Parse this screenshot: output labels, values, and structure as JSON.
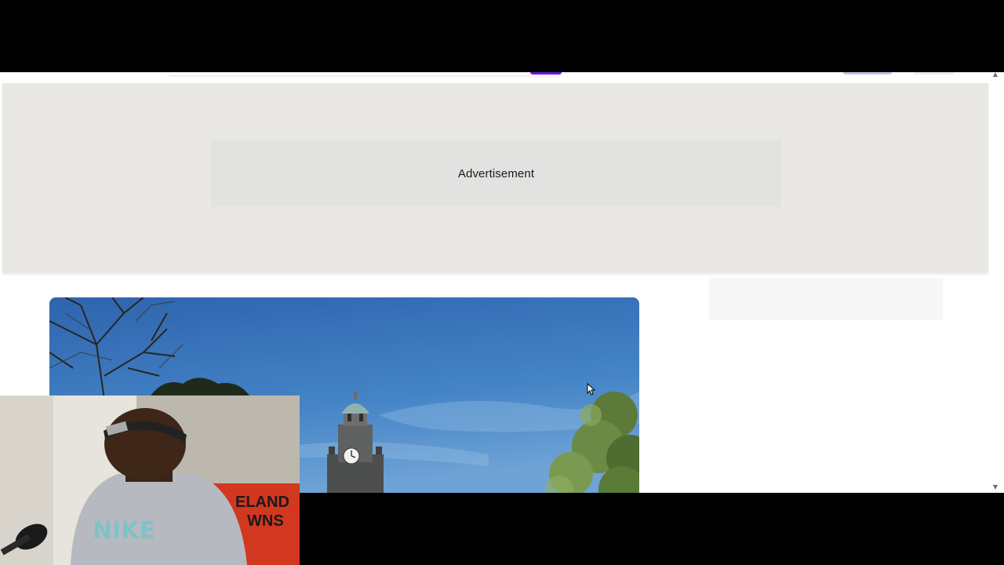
{
  "advertisement": {
    "label": "Advertisement"
  },
  "hero": {
    "subject": "clock tower against blue sky with trees"
  },
  "webcam_overlay": {
    "shirt_text": "NIKE",
    "background_text": "ELAND\nWNS"
  },
  "colors": {
    "page_background": "#ffffff",
    "ad_band": "#e9e8e5",
    "ad_box": "#e2e2e0",
    "search_button_accent": "#6a1be0",
    "sky": "#3f79bf",
    "letterbox": "#000000"
  },
  "icons": {
    "scroll_up": "triangle-up",
    "scroll_down": "triangle-down",
    "cursor": "arrow-pointer"
  }
}
